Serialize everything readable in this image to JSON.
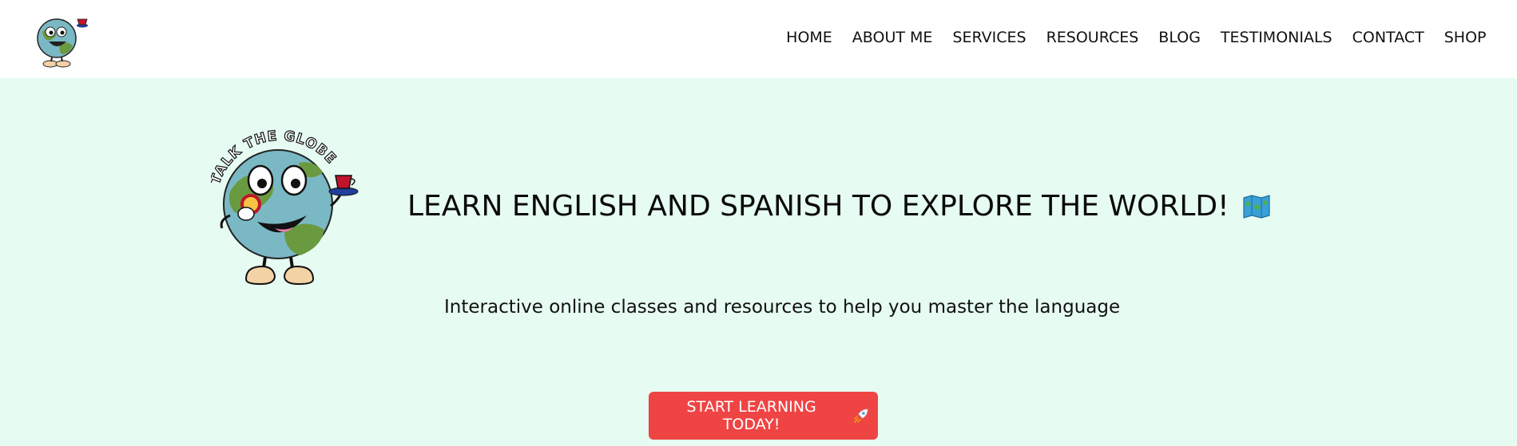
{
  "nav": {
    "logo_name": "talk-the-globe-mascot-logo",
    "items": [
      {
        "label": "HOME"
      },
      {
        "label": "ABOUT ME"
      },
      {
        "label": "SERVICES"
      },
      {
        "label": "RESOURCES"
      },
      {
        "label": "BLOG"
      },
      {
        "label": "TESTIMONIALS"
      },
      {
        "label": "CONTACT"
      },
      {
        "label": "SHOP"
      }
    ]
  },
  "hero": {
    "logo_text": "TALK THE GLOBE",
    "title": "LEARN ENGLISH AND SPANISH TO EXPLORE THE WORLD!",
    "title_icon": "map-icon",
    "subtitle": "Interactive online classes and resources to help you master the language",
    "cta_label": "START LEARNING TODAY!",
    "cta_icon": "rocket-icon"
  },
  "colors": {
    "hero_background": "#e6fbf1",
    "cta_background": "#ef4444",
    "cta_text": "#ffffff",
    "nav_background": "#ffffff"
  }
}
